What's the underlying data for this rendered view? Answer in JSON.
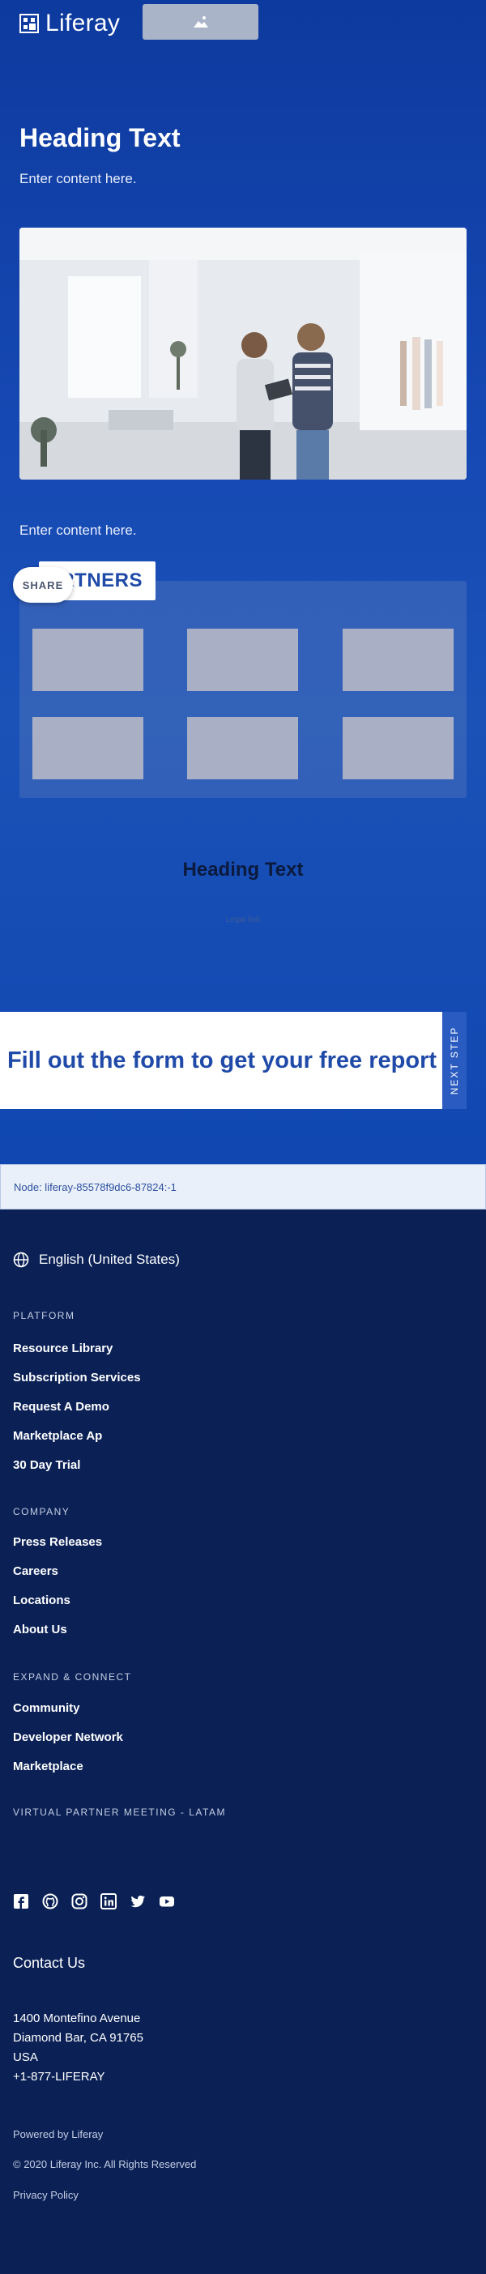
{
  "brand": {
    "name": "Liferay"
  },
  "hero": {
    "heading": "Heading Text",
    "content": "Enter content here.",
    "content_2": "Enter content here."
  },
  "partners": {
    "tab_label": "PARTNERS",
    "share_label": "SHARE"
  },
  "section2": {
    "heading": "Heading Text",
    "legal_link": "Legal link"
  },
  "form_banner": {
    "text": "Fill out the form to get your free report",
    "next_step": "NEXT STEP"
  },
  "node": {
    "text": "Node: liferay-85578f9dc6-87824:-1"
  },
  "footer": {
    "language": "English (United States)",
    "sections": [
      {
        "title": "PLATFORM",
        "links": [
          "Resource Library",
          "Subscription Services",
          "Request A Demo",
          "Marketplace Ap",
          "30 Day Trial"
        ]
      },
      {
        "title": "COMPANY",
        "links": [
          "Press Releases",
          "Careers",
          "Locations",
          "About Us"
        ]
      },
      {
        "title": "EXPAND & CONNECT",
        "links": [
          "Community",
          "Developer Network",
          "Marketplace"
        ]
      },
      {
        "title": "VIRTUAL PARTNER MEETING - LATAM",
        "links": []
      }
    ],
    "social_icons": [
      "facebook-icon",
      "github-icon",
      "instagram-icon",
      "linkedin-icon",
      "twitter-icon",
      "youtube-icon"
    ],
    "contact_title": "Contact Us",
    "address": [
      "1400 Montefino Avenue",
      "Diamond Bar, CA 91765",
      "USA",
      "+1-877-LIFERAY"
    ],
    "powered_by": "Powered by Liferay",
    "copyright": "© 2020 Liferay Inc. All Rights Reserved",
    "privacy": "Privacy Policy"
  },
  "colors": {
    "hero_blue": "#1648b3",
    "footer_navy": "#0b2156",
    "accent_blue": "#1f4aa8"
  }
}
